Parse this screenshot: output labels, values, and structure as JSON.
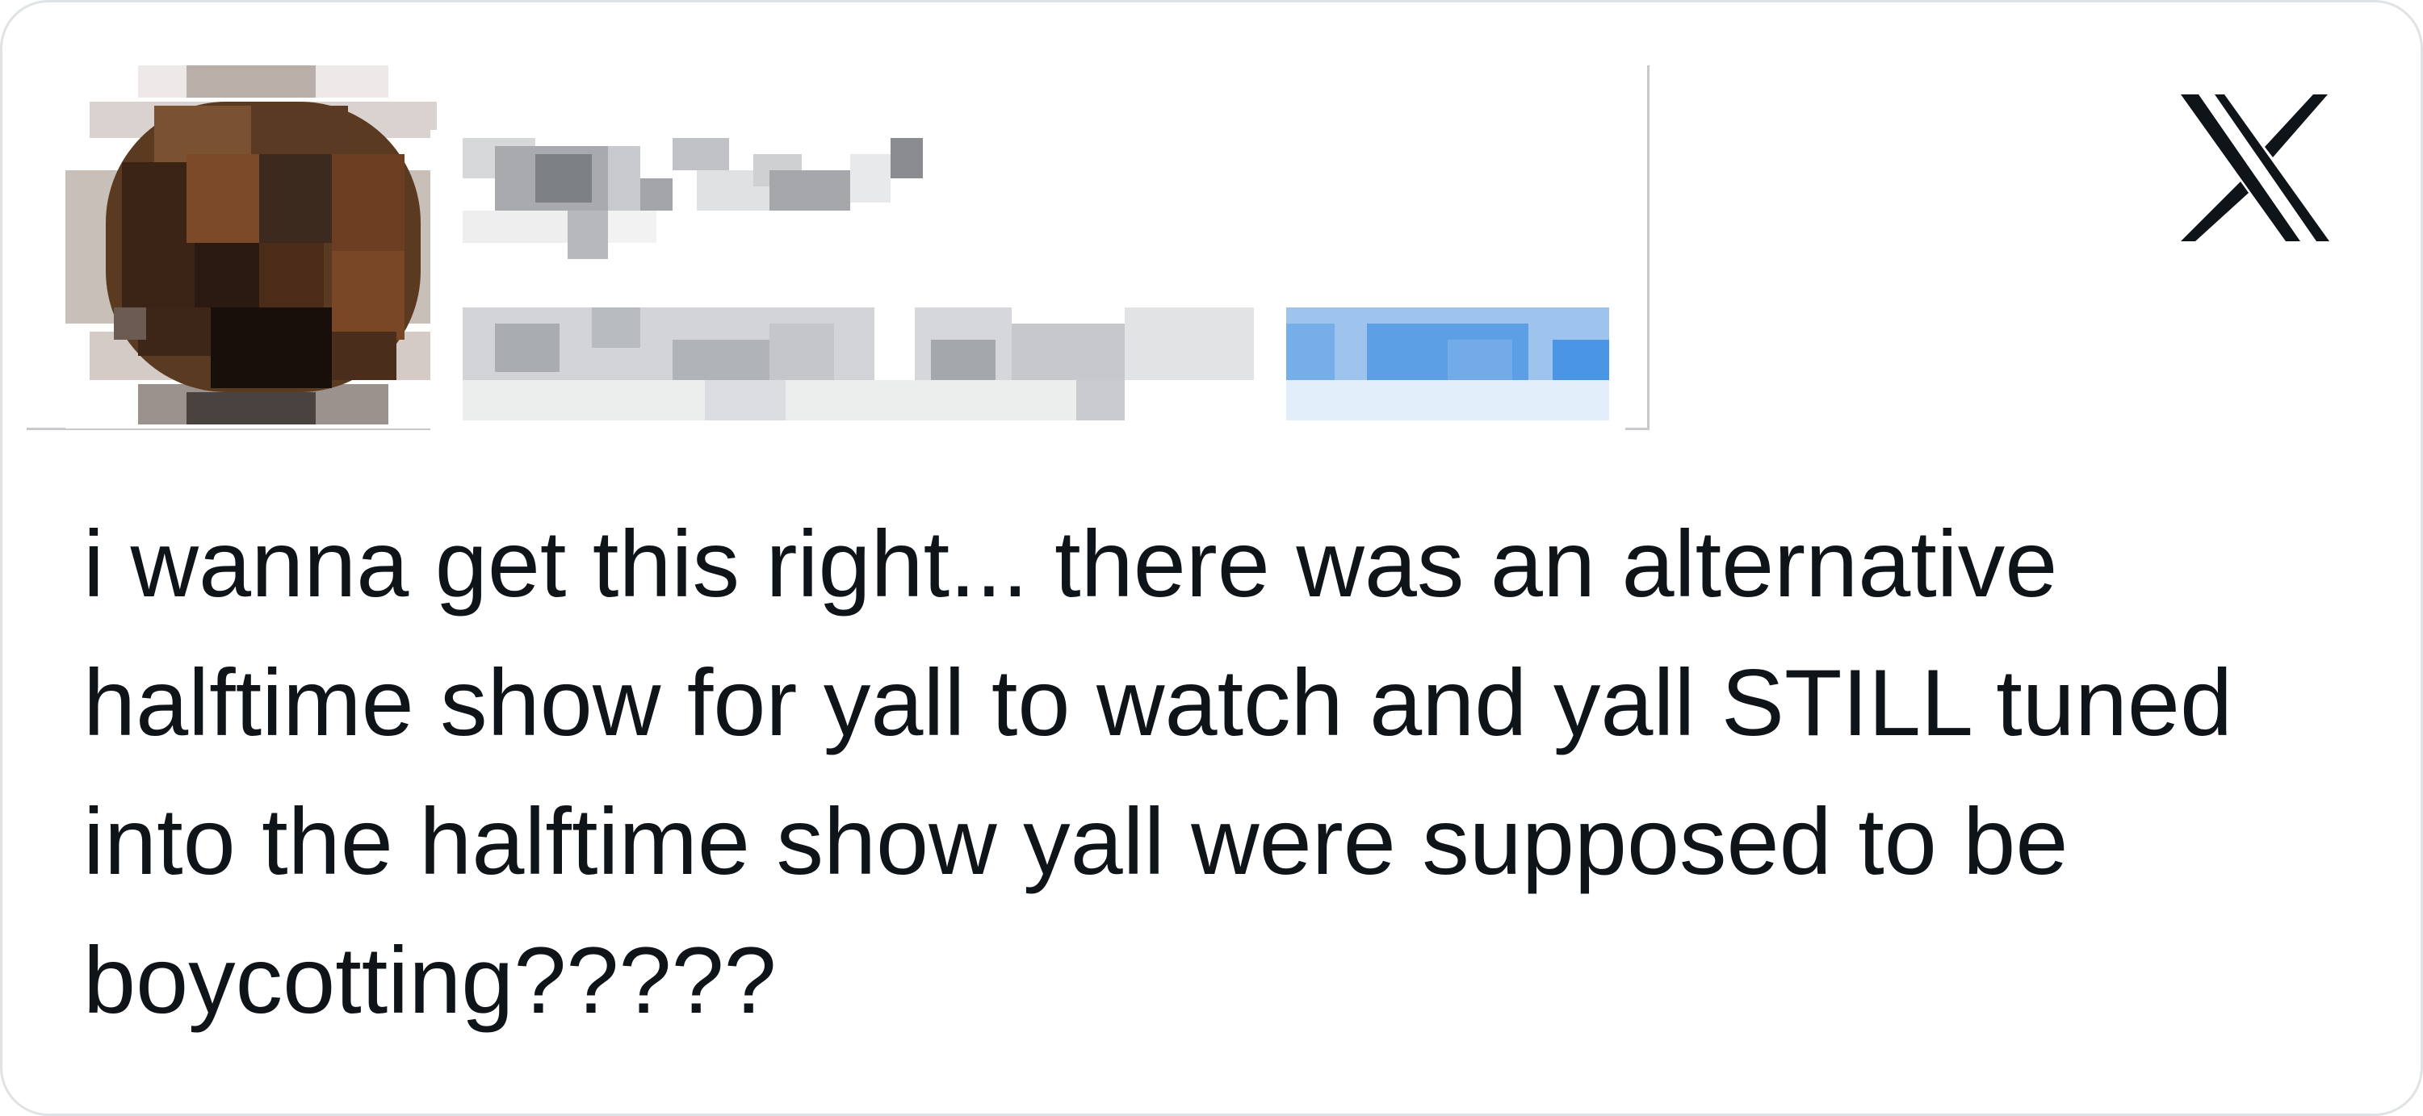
{
  "tweet": {
    "text": "i wanna get this right... there was an alternative halftime show for yall to watch and yall STILL tuned into the halftime show yall were supposed to be boycotting?????"
  },
  "author": {
    "avatar_icon": "pixelated-avatar-icon",
    "display_name_icon": "pixelated-display-name",
    "handle_icon": "pixelated-handle-and-follow"
  },
  "brand": {
    "logo_icon": "x-logo-icon",
    "logo_color": "#0f1419",
    "link_color": "#1d9bf0"
  }
}
